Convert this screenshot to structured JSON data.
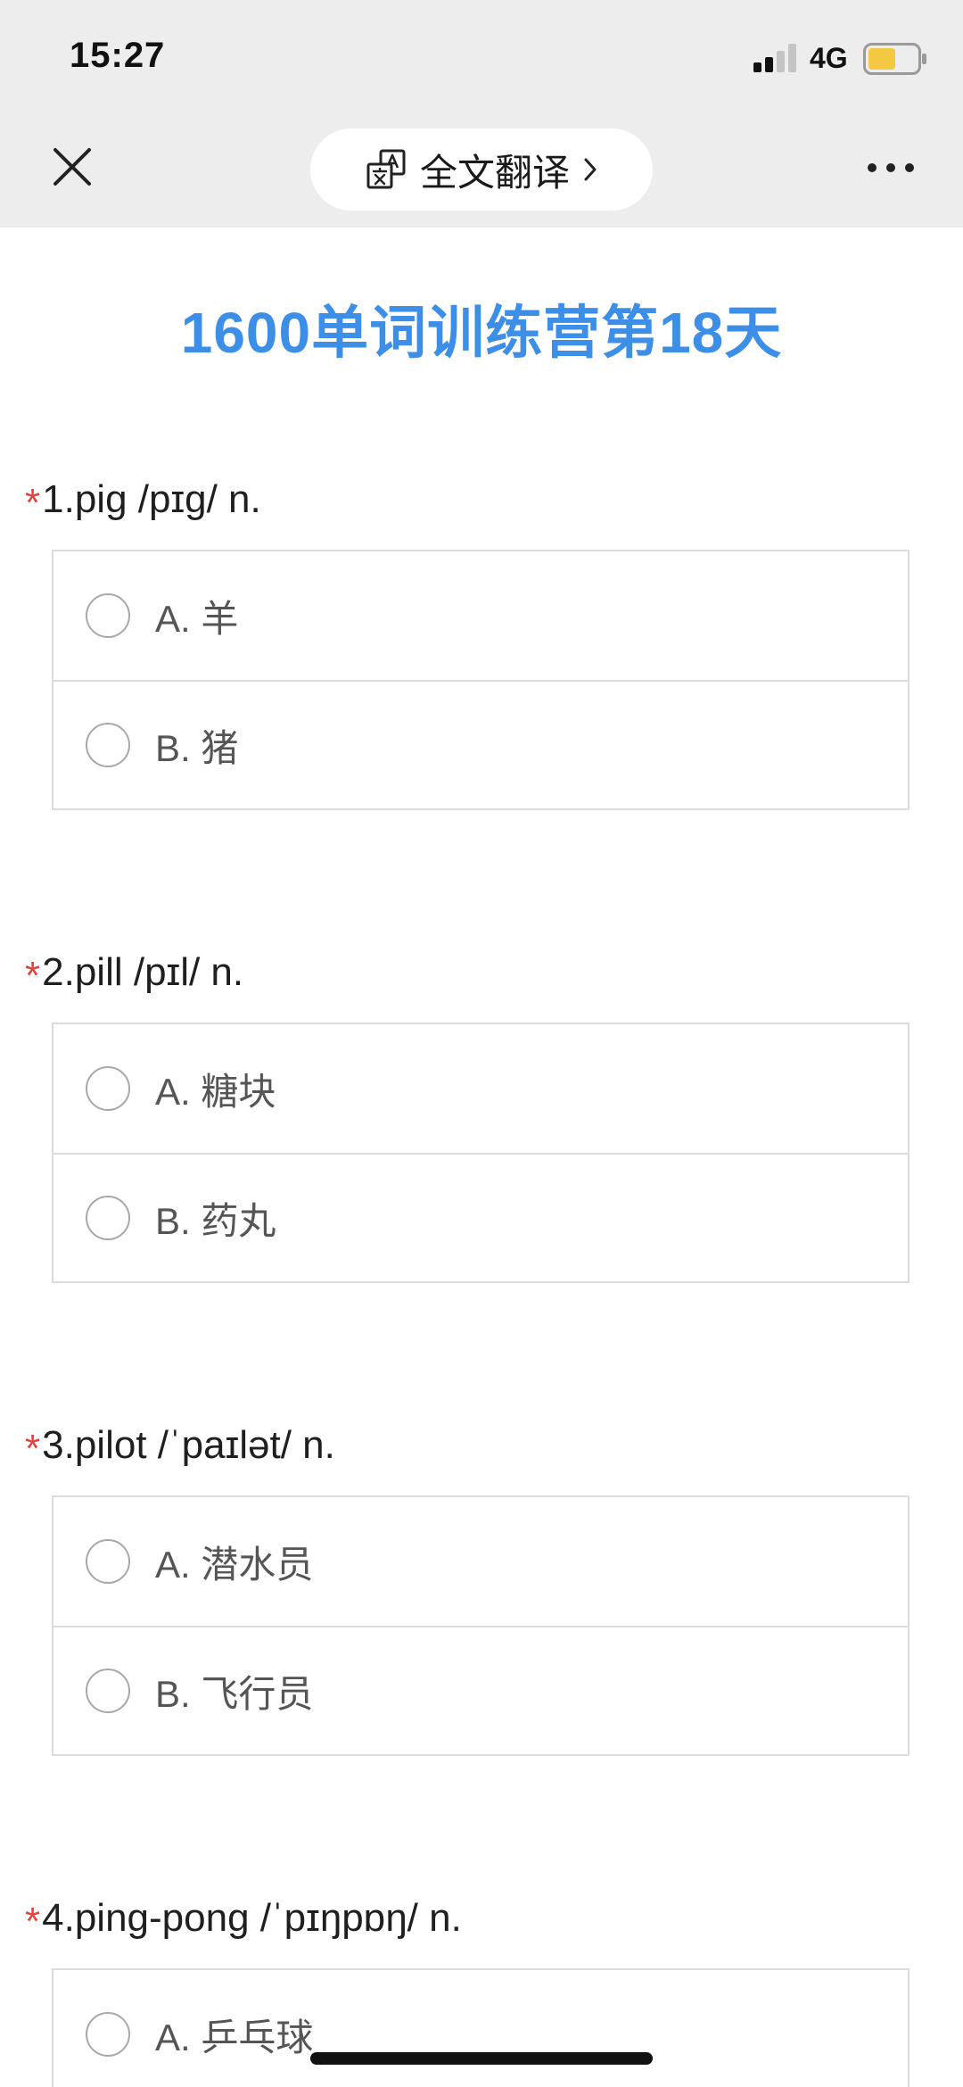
{
  "status_bar": {
    "time": "15:27",
    "network": "4G"
  },
  "nav": {
    "translate_label": "全文翻译",
    "icons": {
      "close": "close-icon",
      "translate": "translate-icon",
      "chevron": "chevron-right-icon",
      "more": "more-icon"
    }
  },
  "page": {
    "title": "1600单词训练营第18天"
  },
  "colors": {
    "title": "#3d8ee6",
    "required_star": "#e0443b",
    "battery_fill": "#f5c842"
  },
  "questions": [
    {
      "required": "*",
      "title": "1.pig /pɪg/ n.",
      "options": [
        {
          "label": "A. 羊"
        },
        {
          "label": "B. 猪"
        }
      ]
    },
    {
      "required": "*",
      "title": "2.pill /pɪl/ n.",
      "options": [
        {
          "label": "A. 糖块"
        },
        {
          "label": "B. 药丸"
        }
      ]
    },
    {
      "required": "*",
      "title": "3.pilot /ˈpaɪlət/ n.",
      "options": [
        {
          "label": "A. 潜水员"
        },
        {
          "label": "B. 飞行员"
        }
      ]
    },
    {
      "required": "*",
      "title": "4.ping-pong /ˈpɪŋpɒŋ/ n.",
      "options": [
        {
          "label": "A. 乒乓球"
        }
      ]
    }
  ]
}
